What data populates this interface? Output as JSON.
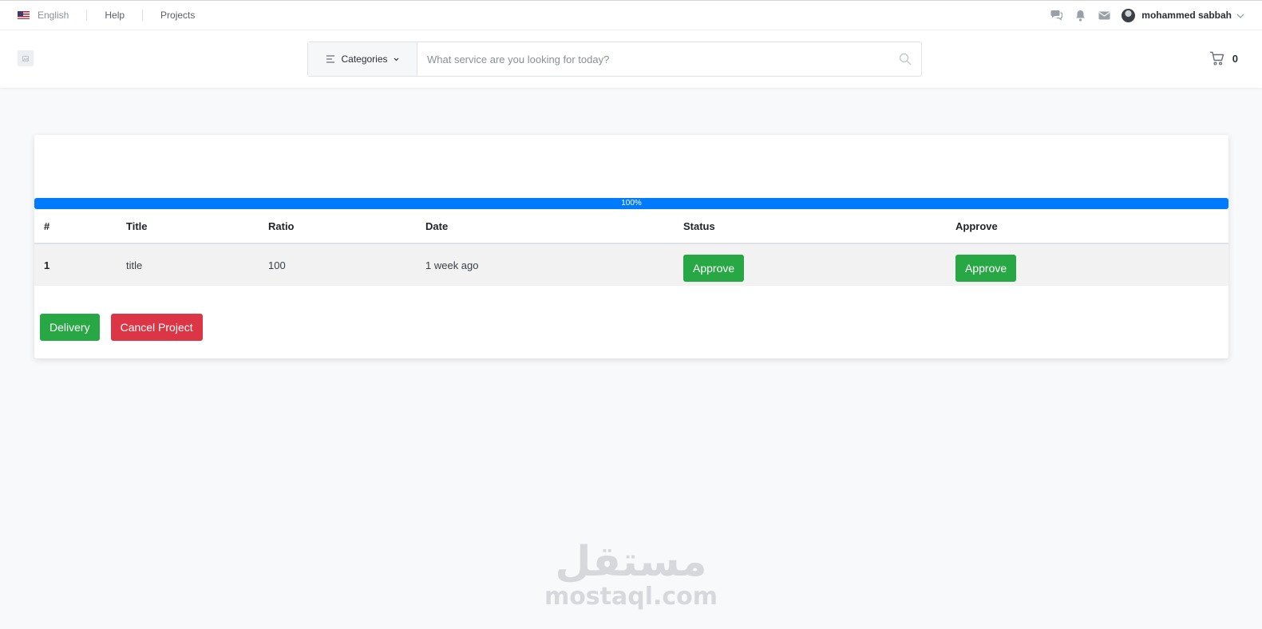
{
  "topbar": {
    "language": "English",
    "help": "Help",
    "projects": "Projects",
    "username": "mohammed sabbah"
  },
  "header": {
    "categories_label": "Categories",
    "search_placeholder": "What service are you looking for today?",
    "cart_count": "0"
  },
  "progress": {
    "value": 100,
    "label": "100%"
  },
  "table": {
    "headers": [
      "#",
      "Title",
      "Ratio",
      "Date",
      "Status",
      "Approve"
    ],
    "rows": [
      {
        "num": "1",
        "title": "title",
        "ratio": "100",
        "date": "1 week ago",
        "status_button": "Approve",
        "approve_button": "Approve"
      }
    ]
  },
  "actions": {
    "delivery": "Delivery",
    "cancel": "Cancel Project"
  },
  "watermark": {
    "arabic": "مستقل",
    "latin": "mostaql.com"
  },
  "colors": {
    "primary": "#007bff",
    "success": "#28a745",
    "danger": "#dc3545"
  }
}
